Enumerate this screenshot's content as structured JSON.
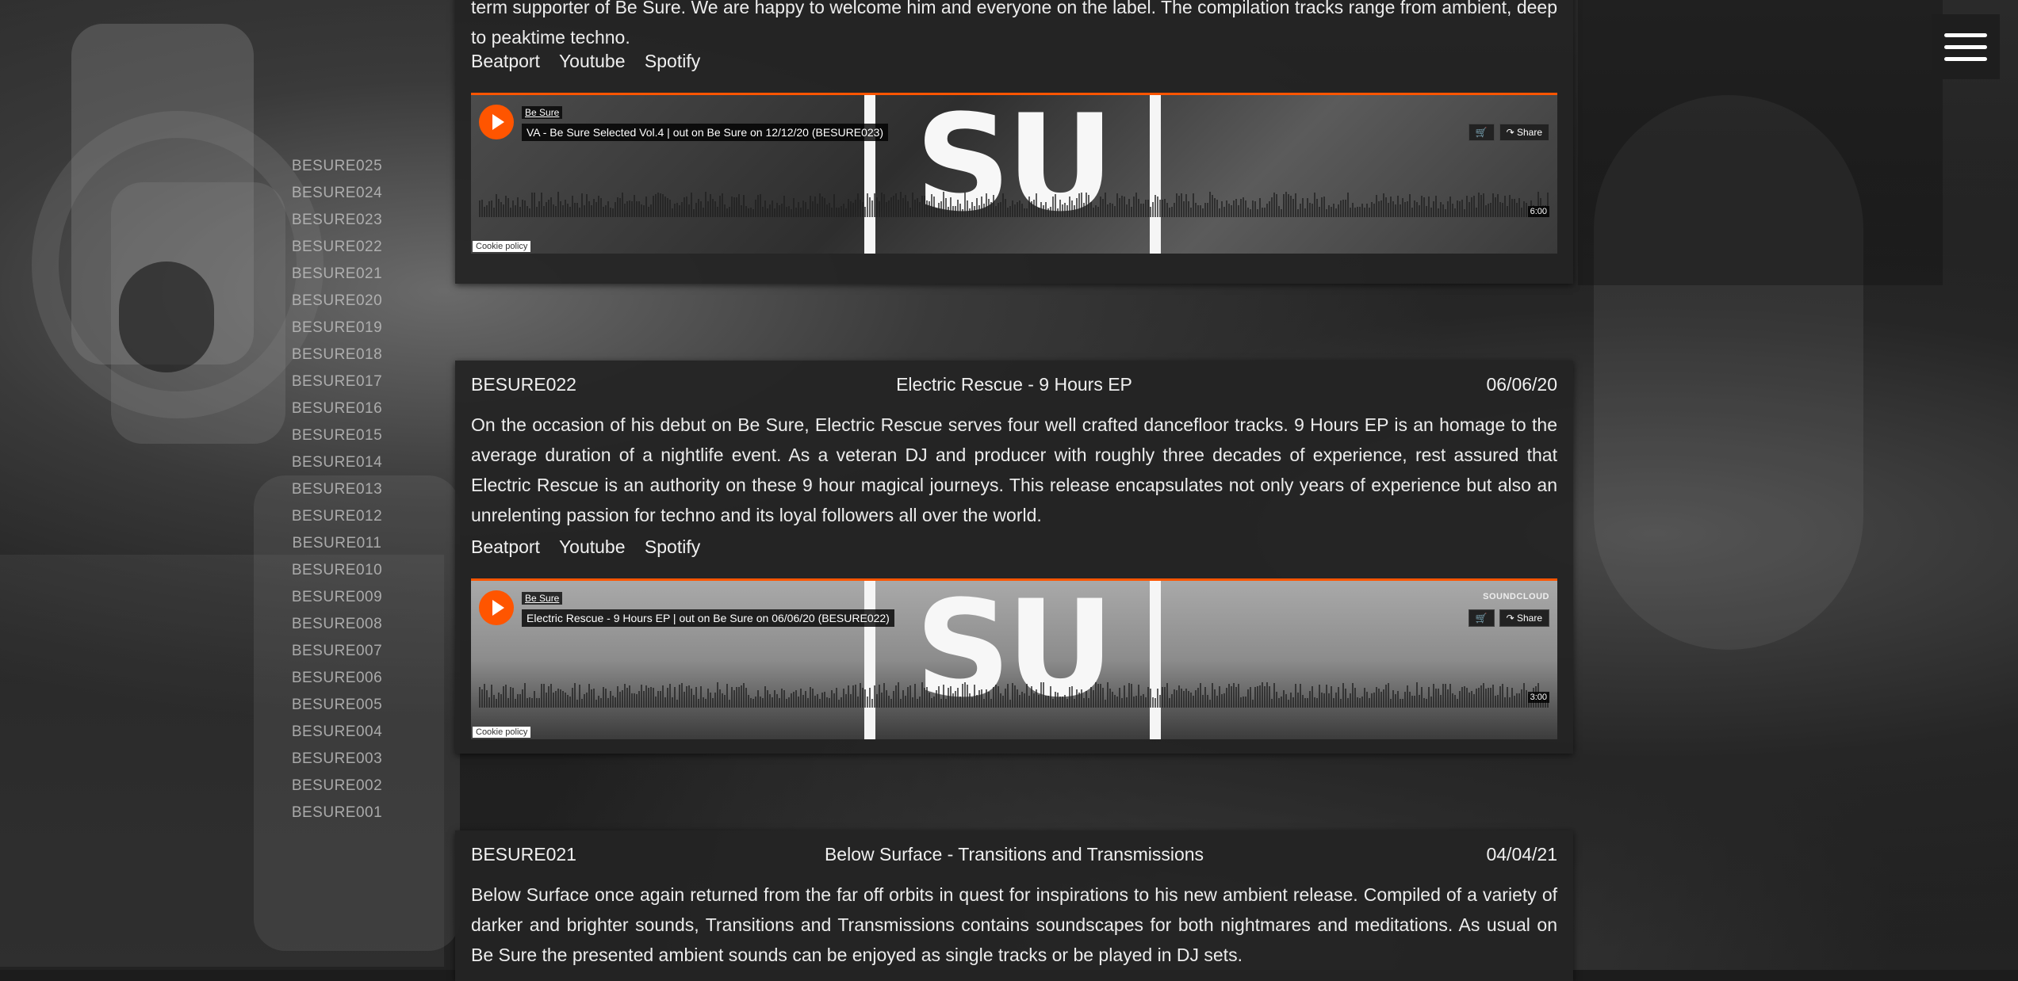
{
  "catalog": [
    "BESURE025",
    "BESURE024",
    "BESURE023",
    "BESURE022",
    "BESURE021",
    "BESURE020",
    "BESURE019",
    "BESURE018",
    "BESURE017",
    "BESURE016",
    "BESURE015",
    "BESURE014",
    "BESURE013",
    "BESURE012",
    "BESURE011",
    "BESURE010",
    "BESURE009",
    "BESURE008",
    "BESURE007",
    "BESURE006",
    "BESURE005",
    "BESURE004",
    "BESURE003",
    "BESURE002",
    "BESURE001"
  ],
  "release_top": {
    "desc_tail": "term supporter of Be Sure. We are happy to welcome him and everyone on the label. The compilation tracks range from ambient, deep to peaktime techno.",
    "links": [
      "Beatport",
      "Youtube",
      "Spotify"
    ],
    "player": {
      "uploader": "Be Sure",
      "track": "VA - Be Sure Selected Vol.4 | out on Be Sure on 12/12/20 (BESURE023)",
      "share": "Share",
      "duration": "6:00",
      "cookie": "Cookie policy",
      "art_text": "SU"
    }
  },
  "release_022": {
    "cat": "BESURE022",
    "title": "Electric Rescue - 9 Hours EP",
    "date": "06/06/20",
    "desc": "On the occasion of his debut on Be Sure, Electric Rescue serves four well crafted dancefloor tracks. 9 Hours EP is an homage to the average duration of a nightlife event. As a veteran DJ and producer with roughly three decades of experience, rest assured that Electric Rescue is an authority on these 9 hour magical journeys. This release encapsulates not only years of experience but also an unrelenting passion for techno and its loyal followers all over the world.",
    "links": [
      "Beatport",
      "Youtube",
      "Spotify"
    ],
    "player": {
      "uploader": "Be Sure",
      "track": "Electric Rescue - 9 Hours EP | out on Be Sure on 06/06/20 (BESURE022)",
      "soundcloud": "SOUNDCLOUD",
      "share": "Share",
      "duration": "3:00",
      "cookie": "Cookie policy",
      "art_text": "SU"
    }
  },
  "release_021": {
    "cat": "BESURE021",
    "title": "Below Surface - Transitions and Transmissions",
    "date": "04/04/21",
    "desc": "Below Surface once again returned from the far off orbits in quest for inspirations to his new ambient release. Compiled of a variety of darker and brighter sounds, Transitions and Transmissions contains soundscapes for both nightmares and meditations. As usual on Be Sure the presented ambient sounds can be enjoyed as single tracks or be played in DJ sets."
  },
  "colors": {
    "accent": "#ff5500",
    "panel": "#242424",
    "text": "#eeeeee"
  },
  "icons": {
    "menu": "hamburger-menu-icon",
    "play": "play-icon",
    "cart": "cart-icon",
    "share": "share-icon"
  }
}
